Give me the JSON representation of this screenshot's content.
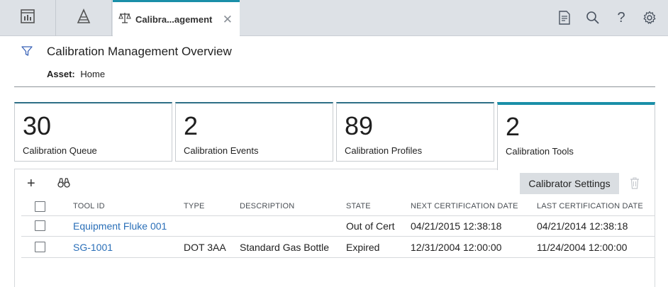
{
  "topbar": {
    "nav_tiles": [
      {
        "icon": "dashboard-icon"
      },
      {
        "icon": "asset-hierarchy-icon"
      }
    ],
    "active_tab": {
      "icon": "scale-icon",
      "label": "Calibra...agement",
      "close_icon": "close-icon"
    },
    "right_icons": [
      "new-document-icon",
      "search-icon",
      "help-icon",
      "gear-icon"
    ],
    "help_glyph": "?"
  },
  "header": {
    "title": "Calibration Management Overview",
    "asset_label": "Asset:",
    "asset_value": "Home"
  },
  "tiles": [
    {
      "count": "30",
      "label": "Calibration Queue"
    },
    {
      "count": "2",
      "label": "Calibration Events"
    },
    {
      "count": "89",
      "label": "Calibration Profiles"
    },
    {
      "count": "2",
      "label": "Calibration Tools",
      "selected": true
    }
  ],
  "toolbar": {
    "add_glyph": "+",
    "calibrator_settings_label": "Calibrator Settings"
  },
  "table": {
    "columns": [
      "TOOL ID",
      "TYPE",
      "DESCRIPTION",
      "STATE",
      "NEXT CERTIFICATION DATE",
      "LAST CERTIFICATION DATE"
    ],
    "rows": [
      {
        "tool_id": "Equipment Fluke 001",
        "type": "",
        "description": "",
        "state": "Out of Cert",
        "next_cert": "04/21/2015 12:38:18",
        "last_cert": "04/21/2014 12:38:18"
      },
      {
        "tool_id": "SG-1001",
        "type": "DOT 3AA",
        "description": "Standard Gas Bottle",
        "state": "Expired",
        "next_cert": "12/31/2004 12:00:00",
        "last_cert": "11/24/2004 12:00:00"
      }
    ]
  },
  "colors": {
    "accent": "#1a8fa8",
    "link": "#2a6fb8",
    "topbar": "#dde1e6"
  }
}
